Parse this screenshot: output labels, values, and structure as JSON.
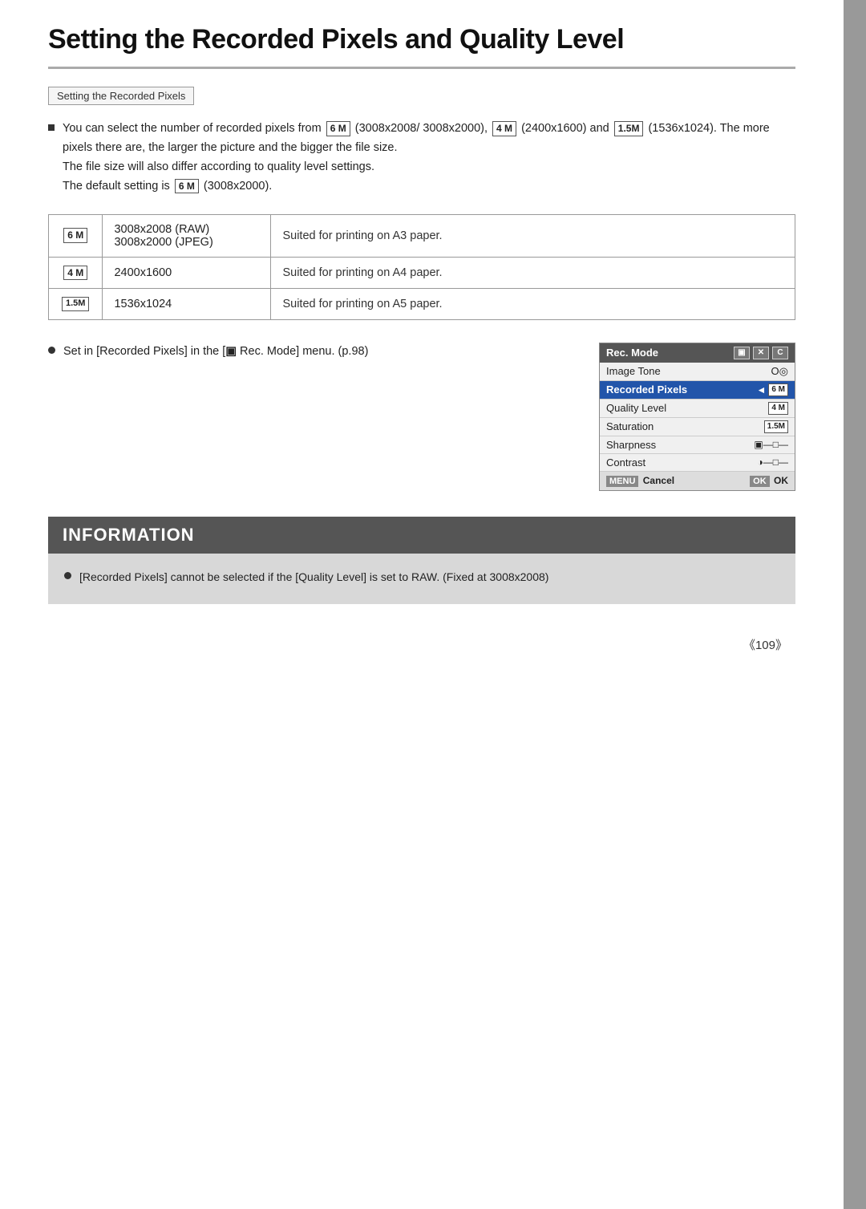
{
  "page": {
    "title": "Setting the Recorded Pixels and Quality Level",
    "side_bar_color": "#999999"
  },
  "section_tab": {
    "label": "Setting the Recorded Pixels"
  },
  "intro_bullet": {
    "text_before": "You can select the number of recorded pixels from ",
    "badge_6m": "6 M",
    "text_mid1": " (3008x2008/ 3008x2000), ",
    "badge_4m": "4 M",
    "text_mid2": " (2400x1600) and ",
    "badge_15m": "1.5M",
    "text_mid3": " (1536x1024). The more pixels there are, the larger the picture and the bigger the file size.",
    "line2": "The file size will also differ according to quality level settings.",
    "line3": "The default setting is ",
    "badge_default": "6 M",
    "text_default_end": " (3008x2000)."
  },
  "table": {
    "rows": [
      {
        "badge": "6 M",
        "dimensions": "3008x2008 (RAW)\n3008x2000 (JPEG)",
        "description": "Suited for printing on A3 paper."
      },
      {
        "badge": "4 M",
        "dimensions": "2400x1600",
        "description": "Suited for printing on A4 paper."
      },
      {
        "badge": "1.5M",
        "dimensions": "1536x1024",
        "description": "Suited for printing on A5 paper."
      }
    ]
  },
  "set_instruction": {
    "text": "Set in [Recorded Pixels] in the [",
    "camera_symbol": "▣",
    "text2": " Rec. Mode] menu. (p.98)"
  },
  "menu_panel": {
    "header_label": "Rec. Mode",
    "header_icons": [
      "▣",
      "✕",
      "C"
    ],
    "rows": [
      {
        "label": "Image Tone",
        "value": "O◎",
        "highlighted": false
      },
      {
        "label": "Recorded Pixels",
        "value": "◄ 6M",
        "highlighted": true
      },
      {
        "label": "Quality Level",
        "value": "4M",
        "highlighted": false
      },
      {
        "label": "Saturation",
        "value": "1.5M",
        "highlighted": false
      },
      {
        "label": "Sharpness",
        "value": "▣—□—",
        "highlighted": false
      },
      {
        "label": "Contrast",
        "value": "◑—□—",
        "highlighted": false
      }
    ],
    "footer_cancel": "Cancel",
    "footer_ok": "OK",
    "footer_menu_label": "MENU",
    "footer_ok_label": "OK"
  },
  "information": {
    "header": "INFORMATION",
    "bullet": "[Recorded Pixels] cannot be selected if the [Quality Level] is set to RAW. (Fixed at 3008x2008)"
  },
  "page_number": "《109》"
}
